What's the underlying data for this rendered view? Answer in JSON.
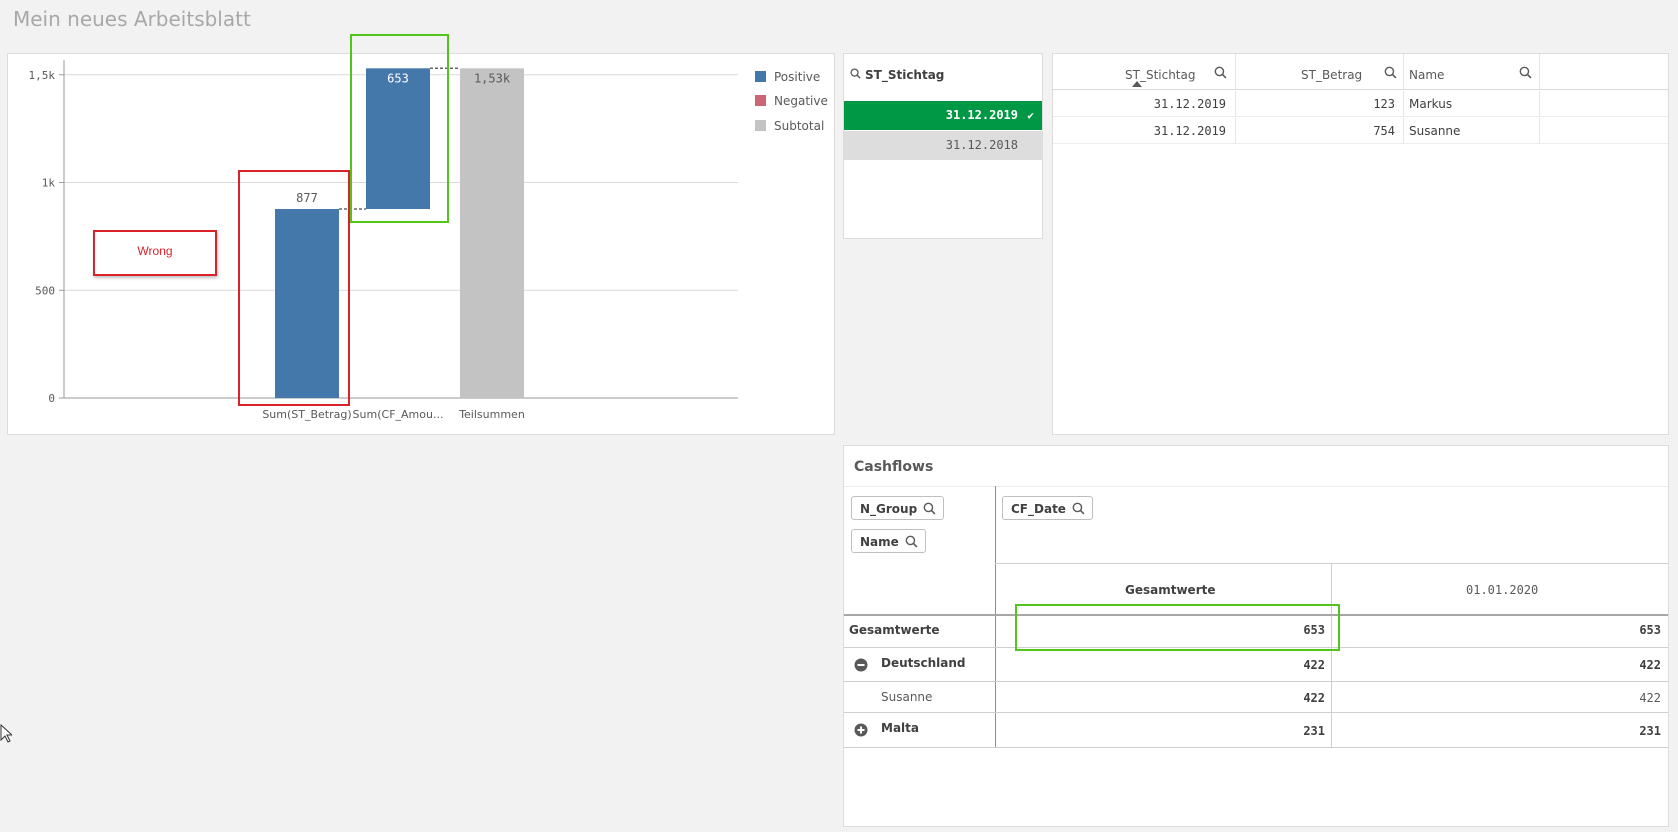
{
  "sheet": {
    "title": "Mein neues Arbeitsblatt"
  },
  "chart_data": {
    "type": "waterfall",
    "categories": [
      "Sum(ST_Betrag)",
      "Sum(CF_Amou...",
      "Teilsummen"
    ],
    "bars": [
      {
        "category": "Sum(ST_Betrag)",
        "kind": "Positive",
        "start": 0,
        "end": 877,
        "label": "877"
      },
      {
        "category": "Sum(CF_Amou...",
        "kind": "Positive",
        "start": 877,
        "end": 1530,
        "label": "653"
      },
      {
        "category": "Teilsummen",
        "kind": "Subtotal",
        "start": 0,
        "end": 1530,
        "label": "1,53k"
      }
    ],
    "yticks": [
      {
        "value": 0,
        "label": "0"
      },
      {
        "value": 500,
        "label": "500"
      },
      {
        "value": 1000,
        "label": "1k"
      },
      {
        "value": 1500,
        "label": "1,5k"
      }
    ],
    "ylim": [
      0,
      1550
    ],
    "legend": [
      {
        "label": "Positive",
        "color": "#4477aa"
      },
      {
        "label": "Negative",
        "color": "#cc6677"
      },
      {
        "label": "Subtotal",
        "color": "#c3c3c3"
      }
    ],
    "legend_position": "right",
    "grid": true
  },
  "annotation": {
    "wrong_text": "Wrong",
    "red_color": "#d9232b",
    "green_color": "#52c41a"
  },
  "filter": {
    "title": "ST_Stichtag",
    "items": [
      {
        "label": "31.12.2019",
        "state": "selected"
      },
      {
        "label": "31.12.2018",
        "state": "alternative"
      }
    ],
    "check": "✔"
  },
  "table": {
    "columns": [
      "ST_Stichtag",
      "ST_Betrag",
      "Name"
    ],
    "rows": [
      [
        "31.12.2019",
        "123",
        "Markus"
      ],
      [
        "31.12.2019",
        "754",
        "Susanne"
      ]
    ]
  },
  "pivot": {
    "title": "Cashflows",
    "row_dims": [
      "N_Group",
      "Name"
    ],
    "col_dim": "CF_Date",
    "col_headers": [
      "Gesamtwerte",
      "01.01.2020"
    ],
    "rows": [
      {
        "label": "Gesamtwerte",
        "values": [
          "653",
          "653"
        ]
      },
      {
        "label": "Deutschland",
        "values": [
          "422",
          "422"
        ]
      },
      {
        "label": "Susanne",
        "values": [
          "422",
          "422"
        ]
      },
      {
        "label": "Malta",
        "values": [
          "231",
          "231"
        ]
      }
    ]
  }
}
